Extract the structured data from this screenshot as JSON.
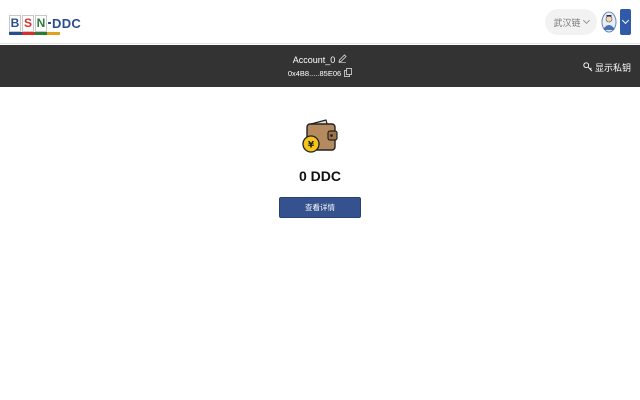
{
  "header": {
    "logo": {
      "letters": [
        "B",
        "S",
        "N"
      ],
      "suffix": "DDC",
      "underline_colors": [
        "#2a4d8f",
        "#d62f2f",
        "#2a7a3a",
        "#e0a020"
      ]
    },
    "chain_select": {
      "label": "武汉链"
    },
    "avatar": {
      "icon": "avatar-icon"
    },
    "account_toggle": {
      "icon": "chevron-down-icon"
    }
  },
  "account": {
    "name": "Account_0",
    "address": "0x4B8.....85E06",
    "edit_icon": "edit-icon",
    "copy_icon": "copy-icon",
    "show_key": {
      "label": "显示私钥",
      "icon": "key-icon"
    }
  },
  "main": {
    "wallet_icon": "wallet-icon",
    "balance": "0 DDC",
    "details_button": "查看详情"
  },
  "colors": {
    "accent": "#35518e",
    "dark_bar": "#333333",
    "toggle": "#2f5aa8"
  }
}
